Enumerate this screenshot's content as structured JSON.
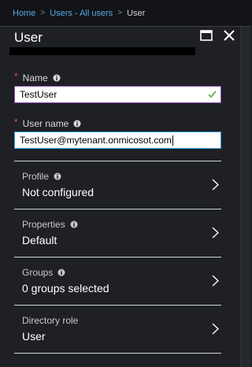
{
  "breadcrumb": {
    "items": [
      "Home",
      "Users - All users",
      "User"
    ],
    "separator": ">"
  },
  "blade": {
    "title": "User",
    "maximize_icon": "maximize-icon",
    "close_icon": "close-icon"
  },
  "form": {
    "name": {
      "label": "Name",
      "value": "TestUser",
      "required_mark": "*"
    },
    "username": {
      "label": "User name",
      "value": "TestUser@mytenant.onmicosot.com",
      "required_mark": "*"
    }
  },
  "sections": [
    {
      "label": "Profile",
      "value": "Not configured"
    },
    {
      "label": "Properties",
      "value": "Default"
    },
    {
      "label": "Groups",
      "value": "0 groups selected"
    },
    {
      "label": "Directory role",
      "value": "User"
    }
  ],
  "colors": {
    "link": "#5aa7e6",
    "required": "#e5484d",
    "valid_check": "#6ab04c",
    "focus_border": "#2f9be8",
    "name_border": "#8a49b4",
    "background": "#1e2023"
  }
}
